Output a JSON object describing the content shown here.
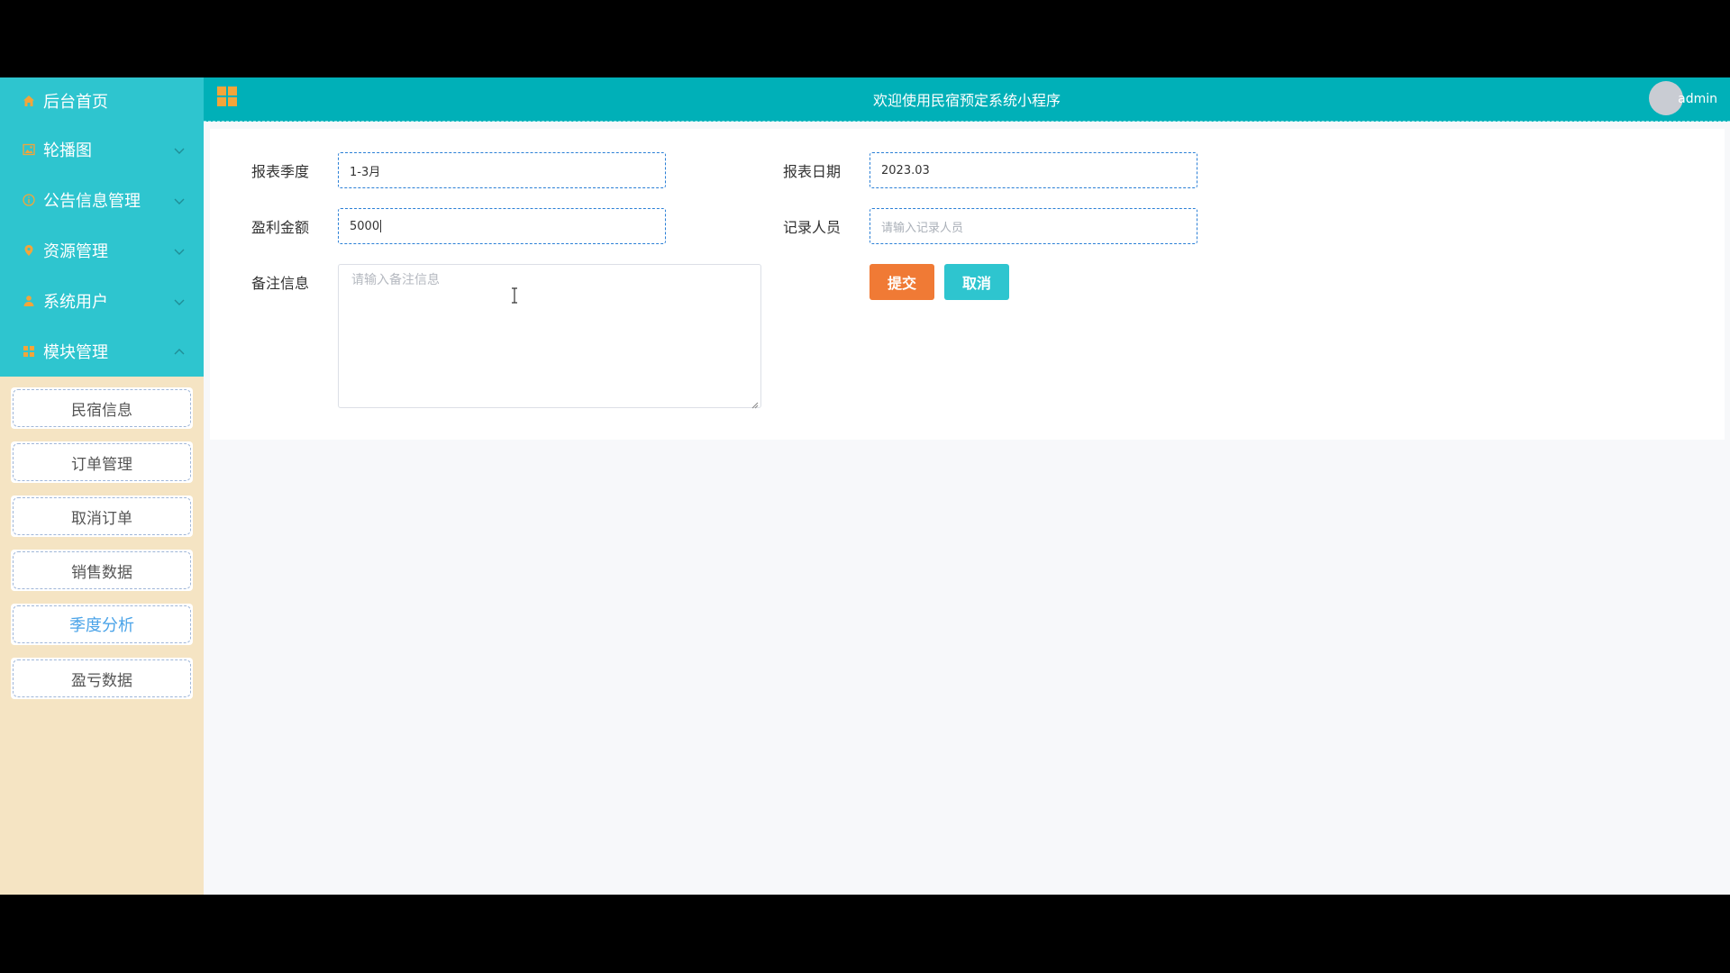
{
  "sidebar": {
    "menu": [
      {
        "label": "后台首页",
        "icon": "home-icon"
      },
      {
        "label": "轮播图",
        "icon": "image-icon"
      },
      {
        "label": "公告信息管理",
        "icon": "info-icon"
      },
      {
        "label": "资源管理",
        "icon": "location-icon"
      },
      {
        "label": "系统用户",
        "icon": "user-icon"
      },
      {
        "label": "模块管理",
        "icon": "grid-icon"
      }
    ],
    "submenu": [
      {
        "label": "民宿信息"
      },
      {
        "label": "订单管理"
      },
      {
        "label": "取消订单"
      },
      {
        "label": "销售数据"
      },
      {
        "label": "季度分析",
        "active": true
      },
      {
        "label": "盈亏数据"
      }
    ]
  },
  "header": {
    "title": "欢迎使用民宿预定系统小程序",
    "username": "admin"
  },
  "form": {
    "season_label": "报表季度",
    "season_value": "1-3月",
    "date_label": "报表日期",
    "date_value": "2023.03",
    "profit_label": "盈利金额",
    "profit_value": "5000",
    "recorder_label": "记录人员",
    "recorder_placeholder": "请输入记录人员",
    "remark_label": "备注信息",
    "remark_placeholder": "请输入备注信息",
    "submit_label": "提交",
    "cancel_label": "取消"
  },
  "colors": {
    "menu_bg": "#2ec5cf",
    "header_bg": "#00b0b8",
    "submenu_bg": "#f5e4c3",
    "submit": "#f07a35",
    "cancel": "#2ec5cf",
    "active_text": "#4aa3e8"
  }
}
